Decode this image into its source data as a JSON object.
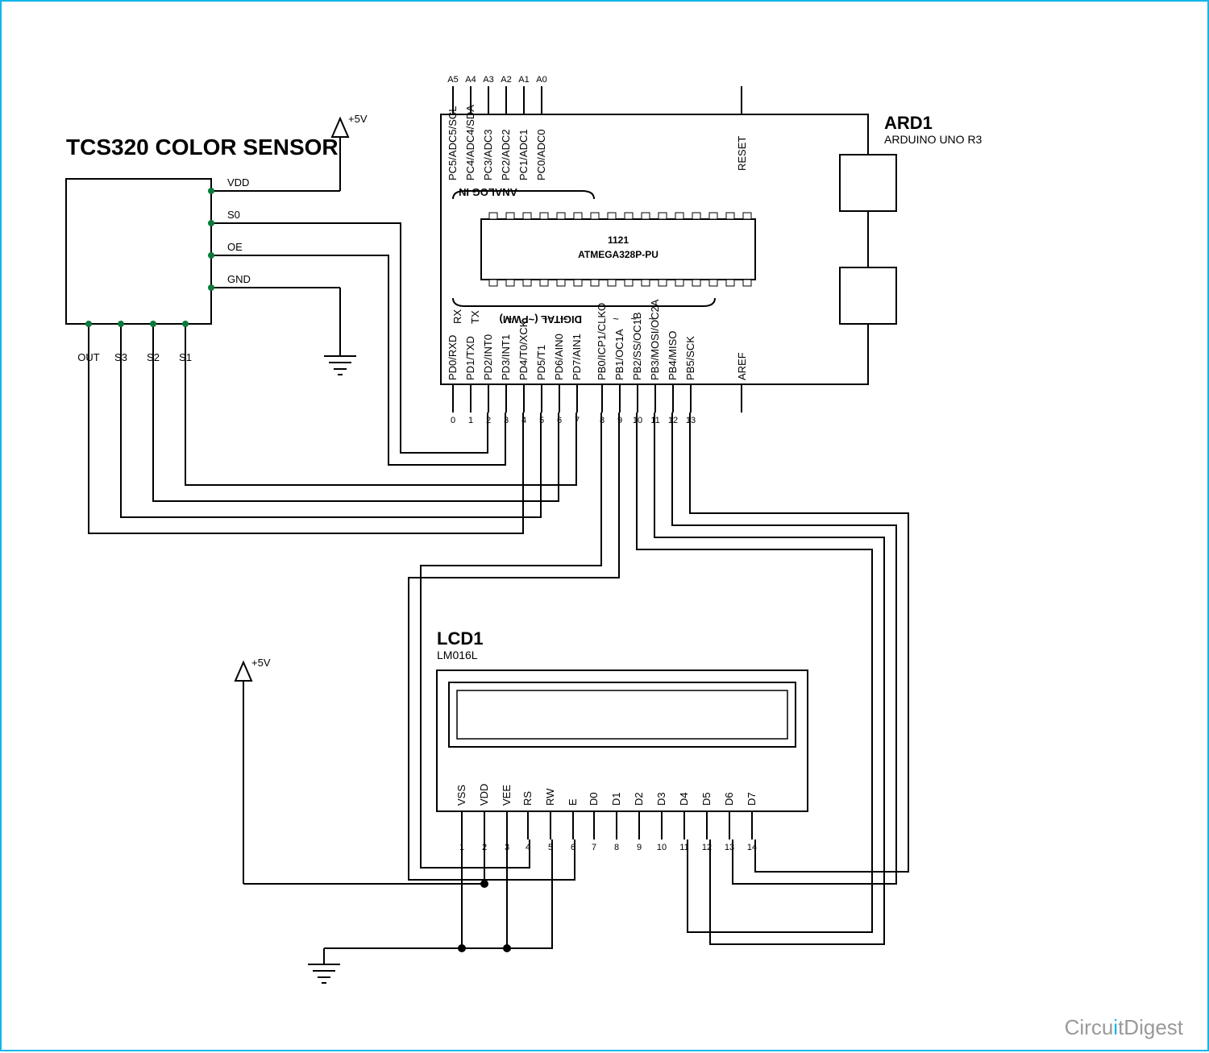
{
  "title": "TCS320 COLOR SENSOR",
  "power_label": "+5V",
  "sensor": {
    "pins_right": [
      "VDD",
      "S0",
      "OE",
      "GND"
    ],
    "pins_bottom": [
      "OUT",
      "S3",
      "S2",
      "S1"
    ]
  },
  "arduino": {
    "ref": "ARD1",
    "part": "ARDUINO UNO R3",
    "chip_line1": "1121",
    "chip_line2": "ATMEGA328P-PU",
    "analog_section": "ANALOG IN",
    "digital_section": "DIGITAL (~PWM)",
    "reset": "RESET",
    "rxtx": [
      "RX",
      "TX"
    ],
    "tilde": "~",
    "aref": "AREF",
    "analog_pins": [
      {
        "num": "A5",
        "name": "PC5/ADC5/SCL"
      },
      {
        "num": "A4",
        "name": "PC4/ADC4/SDA"
      },
      {
        "num": "A3",
        "name": "PC3/ADC3"
      },
      {
        "num": "A2",
        "name": "PC2/ADC2"
      },
      {
        "num": "A1",
        "name": "PC1/ADC1"
      },
      {
        "num": "A0",
        "name": "PC0/ADC0"
      }
    ],
    "digital_pins": [
      {
        "num": "0",
        "name": "PD0/RXD"
      },
      {
        "num": "1",
        "name": "PD1/TXD"
      },
      {
        "num": "2",
        "name": "PD2/INT0"
      },
      {
        "num": "3",
        "name": "PD3/INT1"
      },
      {
        "num": "4",
        "name": "PD4/T0/XCK"
      },
      {
        "num": "5",
        "name": "PD5/T1"
      },
      {
        "num": "6",
        "name": "PD6/AIN0"
      },
      {
        "num": "7",
        "name": "PD7/AIN1"
      },
      {
        "num": "8",
        "name": "PB0/ICP1/CLKO"
      },
      {
        "num": "9",
        "name": "PB1/OC1A"
      },
      {
        "num": "10",
        "name": "PB2/SS/OC1B"
      },
      {
        "num": "11",
        "name": "PB3/MOSI/OC2A"
      },
      {
        "num": "12",
        "name": "PB4/MISO"
      },
      {
        "num": "13",
        "name": "PB5/SCK"
      }
    ]
  },
  "lcd": {
    "ref": "LCD1",
    "part": "LM016L",
    "pins": [
      {
        "num": "1",
        "name": "VSS"
      },
      {
        "num": "2",
        "name": "VDD"
      },
      {
        "num": "3",
        "name": "VEE"
      },
      {
        "num": "4",
        "name": "RS"
      },
      {
        "num": "5",
        "name": "RW"
      },
      {
        "num": "6",
        "name": "E"
      },
      {
        "num": "7",
        "name": "D0"
      },
      {
        "num": "8",
        "name": "D1"
      },
      {
        "num": "9",
        "name": "D2"
      },
      {
        "num": "10",
        "name": "D3"
      },
      {
        "num": "11",
        "name": "D4"
      },
      {
        "num": "12",
        "name": "D5"
      },
      {
        "num": "13",
        "name": "D6"
      },
      {
        "num": "14",
        "name": "D7"
      }
    ]
  },
  "watermark": {
    "a": "Circu",
    "b": "i",
    "c": "tDigest"
  }
}
